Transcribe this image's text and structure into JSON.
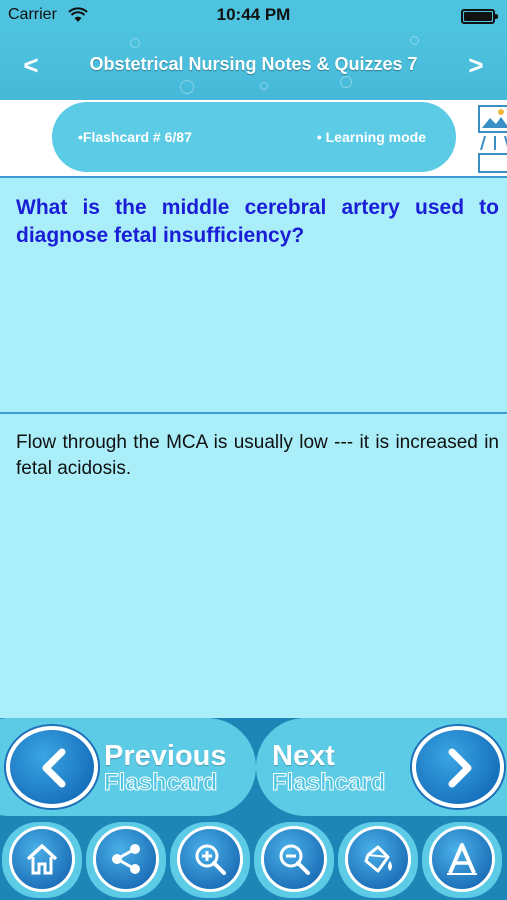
{
  "status_bar": {
    "carrier": "Carrier",
    "time": "10:44 PM"
  },
  "nav_bar": {
    "title": "Obstetrical Nursing Notes & Quizzes 7",
    "back_glyph": "<",
    "forward_glyph": ">"
  },
  "info": {
    "flashcard": "•Flashcard #  6/87",
    "mode": "• Learning mode"
  },
  "question": "What is the middle cerebral artery used to diagnose fetal insufficiency?",
  "answer": "Flow through the MCA is usually low --- it is increased in fetal acidosis.",
  "buttons": {
    "previous": {
      "line1": "Previous",
      "line2": "Flashcard"
    },
    "next": {
      "line1": "Next",
      "line2": "Flashcard"
    }
  },
  "toolbar": [
    "home-icon",
    "share-icon",
    "zoom-in-icon",
    "zoom-out-icon",
    "paint-bucket-icon",
    "font-icon"
  ],
  "colors": {
    "accent": "#4ec3df",
    "card": "#aaeef9",
    "question_text": "#1a1ed6",
    "dark_blue": "#1e86b6"
  }
}
